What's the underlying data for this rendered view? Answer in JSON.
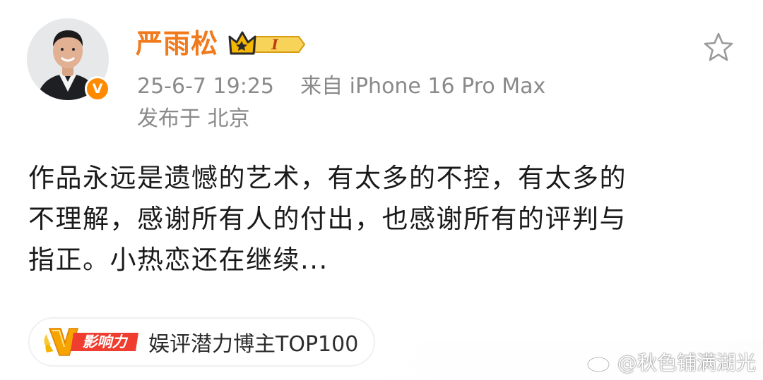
{
  "post": {
    "author": {
      "name": "严雨松",
      "vip_level": "I",
      "verified_icon": "v-badge-icon"
    },
    "meta": {
      "timestamp": "25-6-7 19:25",
      "source": "来自 iPhone 16 Pro Max",
      "location": "发布于 北京"
    },
    "content": {
      "lines": [
        "作品永远是遗憾的艺术，有太多的不控，有太多的",
        "不理解，感谢所有人的付出，也感谢所有的评判与",
        "指正。小热恋还在继续..."
      ]
    },
    "influence": {
      "badge_text": "影响力",
      "badge_letter": "V",
      "title": "娱评潜力博主TOP100"
    },
    "actions": {
      "favorite_icon": "star-icon"
    }
  },
  "watermark": {
    "text": "@秋色铺满湖光"
  },
  "colors": {
    "author_name": "#f17a1c",
    "meta_gray": "#8a8a8a",
    "content_text": "#1a1a1a",
    "verify_orange": "#ff8a00",
    "gold": "#f5b400"
  }
}
